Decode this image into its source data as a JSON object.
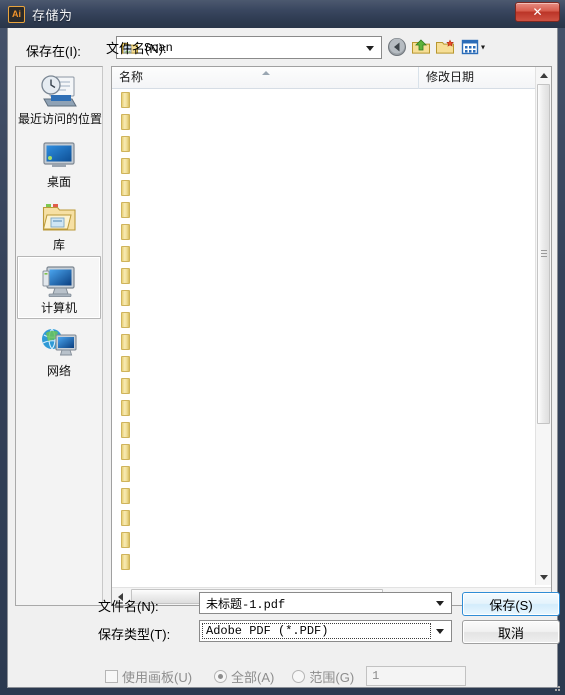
{
  "window": {
    "title": "存储为",
    "app_icon": "Ai",
    "close_label": "✕",
    "titlebar_color": "#2d3a50",
    "accent_color": "#2f8dd6"
  },
  "lookin": {
    "label": "保存在(I):",
    "value": "Scan",
    "icon": "folder-icon",
    "toolbar": [
      {
        "name": "back-button",
        "icon": "back-arrow-icon"
      },
      {
        "name": "up-one-level-button",
        "icon": "up-folder-icon"
      },
      {
        "name": "new-folder-button",
        "icon": "new-folder-icon"
      },
      {
        "name": "views-button",
        "icon": "views-grid-icon"
      }
    ]
  },
  "places": {
    "items": [
      {
        "label": "最近访问的位置",
        "icon": "recent-places-icon",
        "selected": false
      },
      {
        "label": "桌面",
        "icon": "desktop-icon",
        "selected": false
      },
      {
        "label": "库",
        "icon": "libraries-icon",
        "selected": false
      },
      {
        "label": "计算机",
        "icon": "computer-icon",
        "selected": true
      },
      {
        "label": "网络",
        "icon": "network-icon",
        "selected": false
      }
    ]
  },
  "filelist": {
    "columns": [
      {
        "label": "名称",
        "sort": "asc"
      },
      {
        "label": "修改日期",
        "sort": ""
      }
    ],
    "rows": [
      {
        "name": "",
        "icon": "folder-icon"
      },
      {
        "name": "",
        "icon": "folder-icon"
      },
      {
        "name": "",
        "icon": "folder-icon"
      },
      {
        "name": "",
        "icon": "folder-icon"
      },
      {
        "name": "",
        "icon": "folder-icon"
      },
      {
        "name": "",
        "icon": "folder-icon"
      },
      {
        "name": "",
        "icon": "folder-icon"
      },
      {
        "name": "",
        "icon": "folder-icon"
      },
      {
        "name": "",
        "icon": "folder-icon"
      },
      {
        "name": "",
        "icon": "folder-icon"
      },
      {
        "name": "",
        "icon": "folder-icon"
      },
      {
        "name": "",
        "icon": "folder-icon"
      },
      {
        "name": "",
        "icon": "folder-icon"
      },
      {
        "name": "",
        "icon": "folder-icon"
      },
      {
        "name": "",
        "icon": "folder-icon"
      },
      {
        "name": "",
        "icon": "folder-icon"
      },
      {
        "name": "",
        "icon": "folder-icon"
      },
      {
        "name": "",
        "icon": "folder-icon"
      },
      {
        "name": "",
        "icon": "folder-icon"
      },
      {
        "name": "",
        "icon": "folder-icon"
      },
      {
        "name": "",
        "icon": "folder-icon"
      },
      {
        "name": "",
        "icon": "folder-icon"
      }
    ]
  },
  "form": {
    "filename_label": "文件名(N):",
    "filename_value": "未标题-1.pdf",
    "filetype_label": "保存类型(T):",
    "filetype_value": "Adobe PDF (*.PDF)",
    "save_label": "保存(S)",
    "cancel_label": "取消"
  },
  "options": {
    "use_artboards_label": "使用画板(U)",
    "use_artboards_checked": false,
    "all_label": "全部(A)",
    "all_selected": true,
    "range_label": "范围(G)",
    "range_selected": false,
    "range_value": "1"
  }
}
